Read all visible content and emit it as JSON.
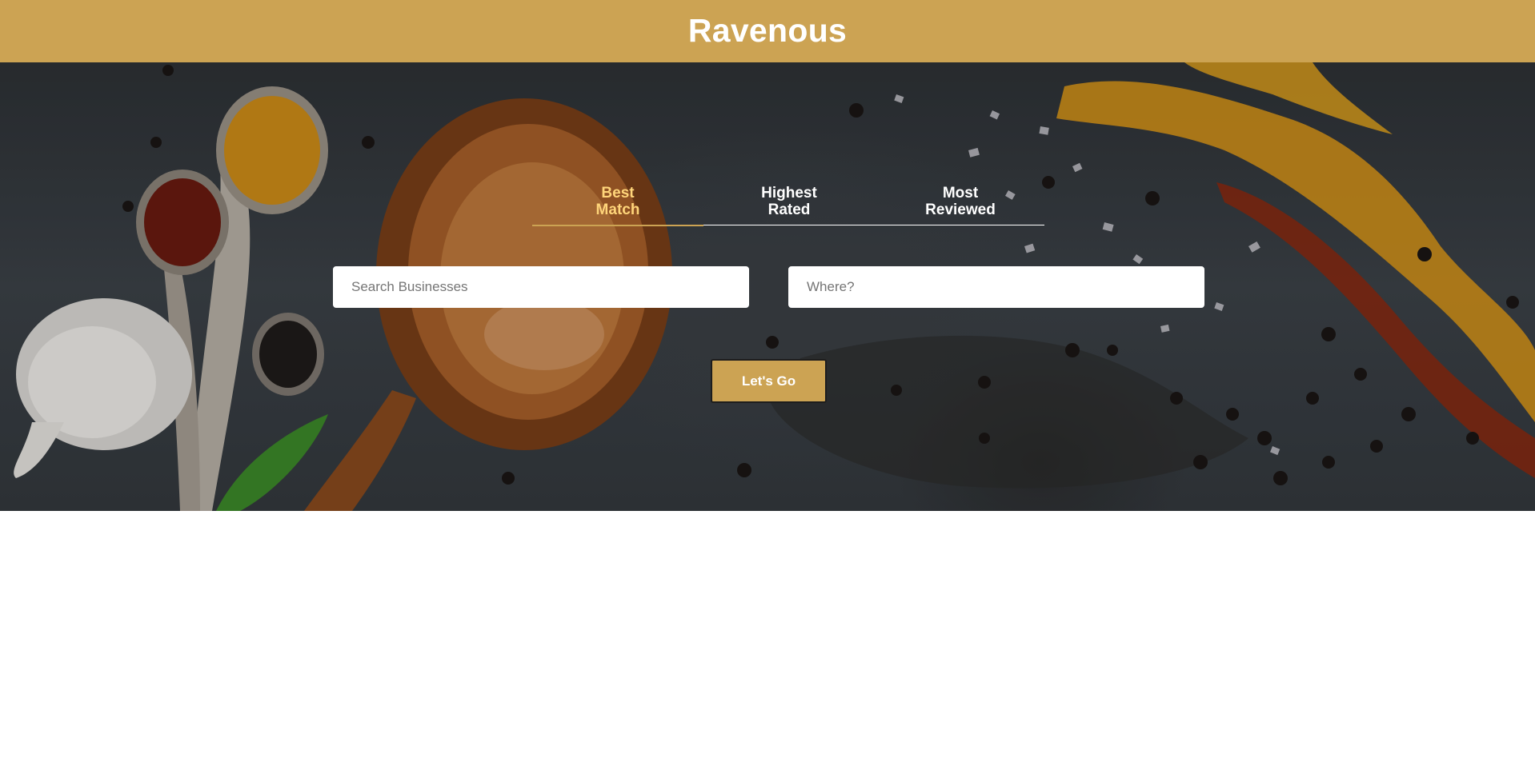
{
  "header": {
    "title": "Ravenous"
  },
  "sort_tabs": [
    {
      "line1": "Best",
      "line2": "Match",
      "active": true
    },
    {
      "line1": "Highest",
      "line2": "Rated",
      "active": false
    },
    {
      "line1": "Most",
      "line2": "Reviewed",
      "active": false
    }
  ],
  "search": {
    "business_placeholder": "Search Businesses",
    "business_value": "",
    "location_placeholder": "Where?",
    "location_value": ""
  },
  "submit": {
    "label": "Let's Go"
  },
  "colors": {
    "brand": "#cca353",
    "active_tab": "#ffd57a",
    "tab_text": "#ffffff"
  }
}
